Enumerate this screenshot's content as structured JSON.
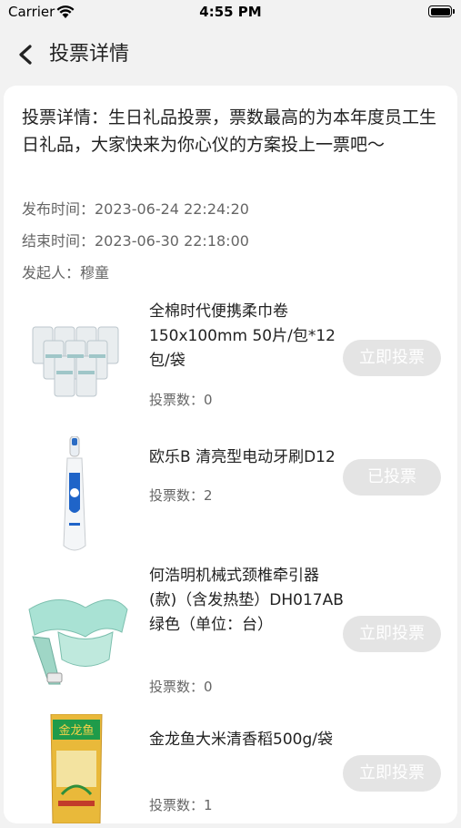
{
  "status_bar": {
    "carrier": "Carrier",
    "time": "4:55 PM"
  },
  "nav": {
    "title": "投票详情"
  },
  "detail": {
    "description": "投票详情：生日礼品投票，票数最高的为本年度员工生日礼品，大家快来为你心仪的方案投上一票吧～",
    "publish_time": "发布时间：2023-06-24 22:24:20",
    "end_time": "结束时间：2023-06-30 22:18:00",
    "initiator": "发起人：穆童"
  },
  "items": [
    {
      "name": "全棉时代便携柔巾卷150x100mm 50片/包*12包/袋",
      "votes": "投票数：0",
      "button": "立即投票"
    },
    {
      "name": "欧乐B 清亮型电动牙刷D12",
      "votes": "投票数：2",
      "button": "已投票"
    },
    {
      "name": "何浩明机械式颈椎牵引器(款)（含发热垫）DH017AB绿色（单位：台）",
      "votes": "投票数：0",
      "button": "立即投票"
    },
    {
      "name": "金龙鱼大米清香稻500g/袋",
      "votes": "投票数：1",
      "button": "立即投票"
    }
  ]
}
